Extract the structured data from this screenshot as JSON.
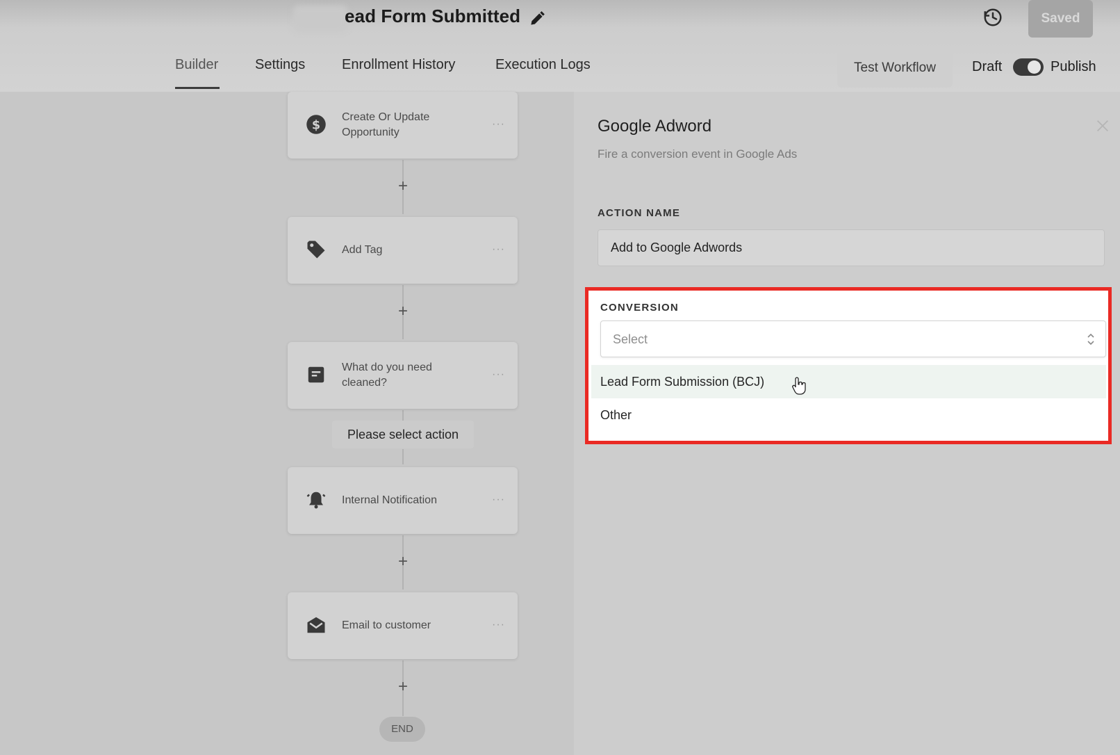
{
  "header": {
    "workflow_title": "ead Form Submitted",
    "saved_label": "Saved",
    "tabs": [
      {
        "label": "Builder",
        "active": true
      },
      {
        "label": "Settings",
        "active": false
      },
      {
        "label": "Enrollment History",
        "active": false
      },
      {
        "label": "Execution Logs",
        "active": false
      }
    ],
    "test_workflow_label": "Test Workflow",
    "draft_label": "Draft",
    "publish_label": "Publish",
    "publish_toggle_on": true,
    "icons": [
      "edit-icon",
      "history-icon"
    ]
  },
  "workflow": {
    "nodes": [
      {
        "label": "Create Or Update Opportunity",
        "icon": "dollar-circle-icon"
      },
      {
        "label": "Add Tag",
        "icon": "tag-icon"
      },
      {
        "label": "What do you need cleaned?",
        "icon": "form-icon"
      },
      {
        "label": "Internal Notification",
        "icon": "bell-icon"
      },
      {
        "label": "Email to customer",
        "icon": "envelope-icon"
      }
    ],
    "please_select_label": "Please select action",
    "add_symbol": "+",
    "node_menu_symbol": "···",
    "end_label": "END"
  },
  "panel": {
    "title": "Google Adword",
    "subtitle": "Fire a conversion event in Google Ads",
    "action_name_label": "ACTION NAME",
    "action_name_value": "Add to Google Adwords",
    "conversion_label": "CONVERSION",
    "conversion_placeholder": "Select",
    "conversion_options": [
      "Lead Form Submission (BCJ)",
      "Other"
    ],
    "hovered_option": "Lead Form Submission (BCJ)"
  },
  "colors": {
    "highlight_border": "#ea2a24",
    "hover_option_bg": "#eef4f0"
  }
}
